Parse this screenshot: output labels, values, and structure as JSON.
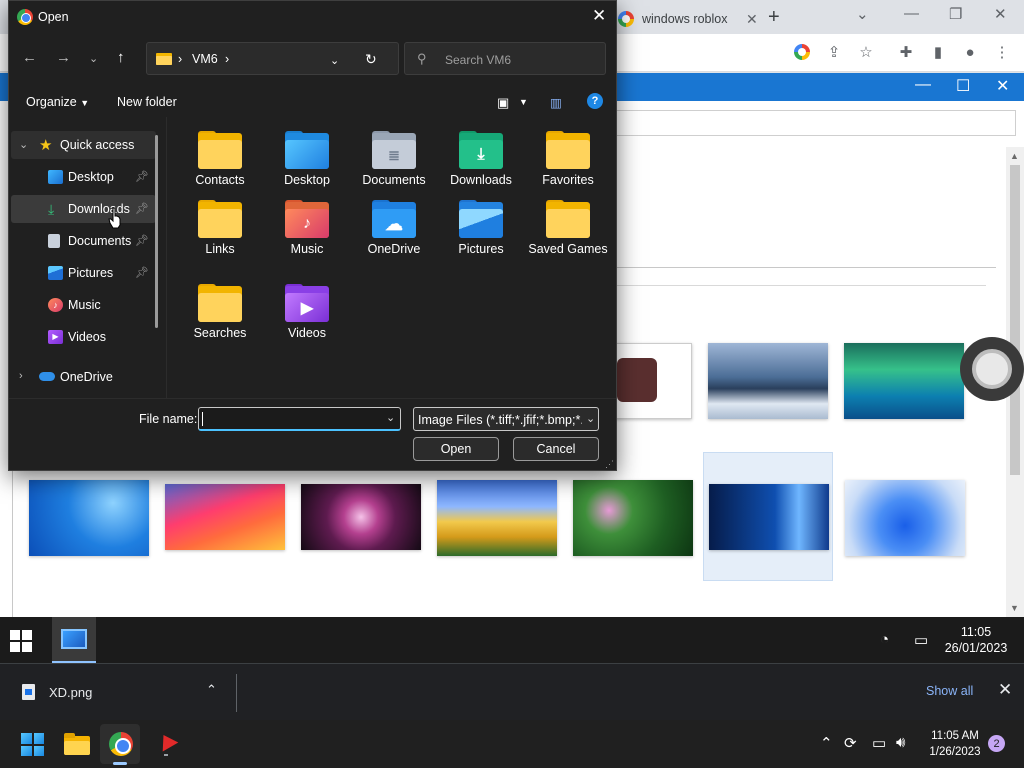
{
  "chrome": {
    "tab_title": "windows roblox",
    "tab_close": "✕",
    "new_tab": "+"
  },
  "gallery": {
    "wallpapers_row1": [
      {
        "colors": [
          "#c53b3b",
          "#a23030"
        ]
      },
      {
        "colors": [
          "#6f8fb5",
          "#e9eef5"
        ]
      },
      {
        "colors": [
          "#33a26f",
          "#0a6fa0"
        ]
      }
    ],
    "wallpapers_row2": [
      {
        "colors": [
          "#2a6fd6",
          "#0e4fae"
        ]
      },
      {
        "colors": [
          "#ff3d6e",
          "#ffb23c"
        ]
      },
      {
        "colors": [
          "#6b2a5a",
          "#1c0c1a"
        ]
      },
      {
        "colors": [
          "#f2c94c",
          "#3b6fd1"
        ]
      },
      {
        "colors": [
          "#2e7d32",
          "#c26aa8"
        ]
      },
      {
        "colors": [
          "#0a2c6e",
          "#2f7fe0"
        ]
      },
      {
        "colors": [
          "#1f5fe0",
          "#7aa8f5"
        ]
      }
    ]
  },
  "vm_taskbar": {
    "time": "11:05",
    "date": "26/01/2023"
  },
  "download_shelf": {
    "file_name": "XD.png",
    "show_all": "Show all"
  },
  "host_taskbar": {
    "time": "11:05 AM",
    "date": "1/26/2023",
    "notifications": "2"
  },
  "dialog": {
    "title": "Open",
    "breadcrumb": [
      "VM6"
    ],
    "search_placeholder": "Search VM6",
    "organize_label": "Organize",
    "new_folder_label": "New folder",
    "nav_items": [
      {
        "label": "Quick access",
        "icon": "star-icon",
        "pinned": false
      },
      {
        "label": "Desktop",
        "icon": "desktop-icon",
        "pinned": true
      },
      {
        "label": "Downloads",
        "icon": "download-icon",
        "pinned": true
      },
      {
        "label": "Documents",
        "icon": "documents-icon",
        "pinned": true
      },
      {
        "label": "Pictures",
        "icon": "pictures-icon",
        "pinned": true
      },
      {
        "label": "Music",
        "icon": "music-icon",
        "pinned": false
      },
      {
        "label": "Videos",
        "icon": "videos-icon",
        "pinned": false
      },
      {
        "label": "OneDrive",
        "icon": "cloud-icon",
        "pinned": false
      }
    ],
    "files": [
      {
        "label": "Contacts",
        "type": "folder"
      },
      {
        "label": "Desktop",
        "type": "desktop"
      },
      {
        "label": "Documents",
        "type": "documents"
      },
      {
        "label": "Downloads",
        "type": "downloads"
      },
      {
        "label": "Favorites",
        "type": "folder"
      },
      {
        "label": "Links",
        "type": "folder"
      },
      {
        "label": "Music",
        "type": "music"
      },
      {
        "label": "OneDrive",
        "type": "onedrive"
      },
      {
        "label": "Pictures",
        "type": "pictures"
      },
      {
        "label": "Saved Games",
        "type": "folder"
      },
      {
        "label": "Searches",
        "type": "folder"
      },
      {
        "label": "Videos",
        "type": "videos"
      }
    ],
    "file_name_label": "File name:",
    "file_name_value": "",
    "filter_value": "Image Files (*.tiff;*.jfif;*.bmp;*.p",
    "open_button": "Open",
    "cancel_button": "Cancel"
  }
}
